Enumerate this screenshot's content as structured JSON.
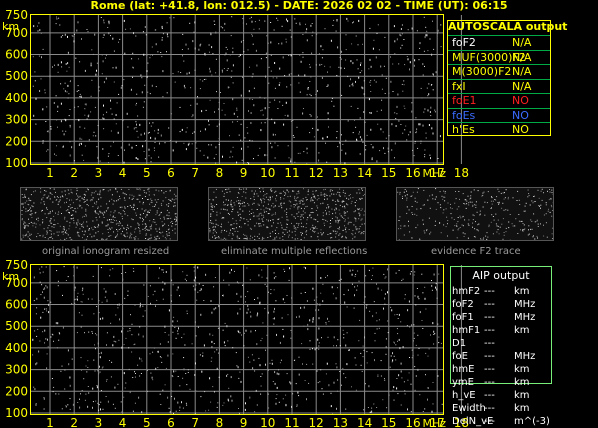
{
  "header": {
    "title": "Rome (lat: +41.8, lon: 012.5) - DATE: 2026 02 02 - TIME (UT): 06:15"
  },
  "ionogram": {
    "y_unit": "km",
    "x_unit": "MHz",
    "y_ticks": [
      "100",
      "200",
      "300",
      "400",
      "500",
      "600",
      "700",
      "750"
    ],
    "x_ticks": [
      "1",
      "2",
      "3",
      "4",
      "5",
      "6",
      "7",
      "8",
      "9",
      "10",
      "11",
      "12",
      "13",
      "14",
      "15",
      "16",
      "17",
      "18"
    ]
  },
  "autoscala": {
    "title": "AUTOSCALA output",
    "rows": [
      {
        "name": "foF2",
        "value": "N/A",
        "name_color": "#ffffff",
        "value_color": "#ffff00"
      },
      {
        "name": "MUF(3000)F2",
        "value": "N/A",
        "name_color": "#ffff00",
        "value_color": "#ffff00"
      },
      {
        "name": "M(3000)F2",
        "value": "N/A",
        "name_color": "#ffff00",
        "value_color": "#ffff00"
      },
      {
        "name": "fxI",
        "value": "N/A",
        "name_color": "#ffff00",
        "value_color": "#ffff00"
      },
      {
        "name": "foE1",
        "value": "NO",
        "name_color": "#ff2020",
        "value_color": "#ff2020"
      },
      {
        "name": "foEs",
        "value": "NO",
        "name_color": "#3a6cff",
        "value_color": "#3a6cff"
      },
      {
        "name": "h'Es",
        "value": "NO",
        "name_color": "#ffff00",
        "value_color": "#ffff00"
      }
    ]
  },
  "thumbnails": [
    {
      "label": "original ionogram resized"
    },
    {
      "label": "eliminate multiple reflections"
    },
    {
      "label": "evidence F2 trace"
    }
  ],
  "aip": {
    "title": "AIP output",
    "rows": [
      {
        "name": "hmF2",
        "value": "---",
        "unit": "km"
      },
      {
        "name": "foF2",
        "value": "---",
        "unit": "MHz"
      },
      {
        "name": "foF1",
        "value": "---",
        "unit": "MHz"
      },
      {
        "name": "hmF1",
        "value": "---",
        "unit": "km"
      },
      {
        "name": "D1",
        "value": "---",
        "unit": ""
      },
      {
        "name": "foE",
        "value": "---",
        "unit": "MHz"
      },
      {
        "name": "hmE",
        "value": "---",
        "unit": "km"
      },
      {
        "name": "ymE",
        "value": "---",
        "unit": "km"
      },
      {
        "name": "h_vE",
        "value": "---",
        "unit": "km"
      },
      {
        "name": "Ewidth",
        "value": "---",
        "unit": "km"
      },
      {
        "name": "DelN_vE",
        "value": "---",
        "unit": "m^(-3)"
      }
    ]
  },
  "colors": {
    "frame": "#ffff00",
    "grid": "#8a8a8a",
    "tick_label": "#ffff00",
    "aip_frame": "#77ee77"
  }
}
